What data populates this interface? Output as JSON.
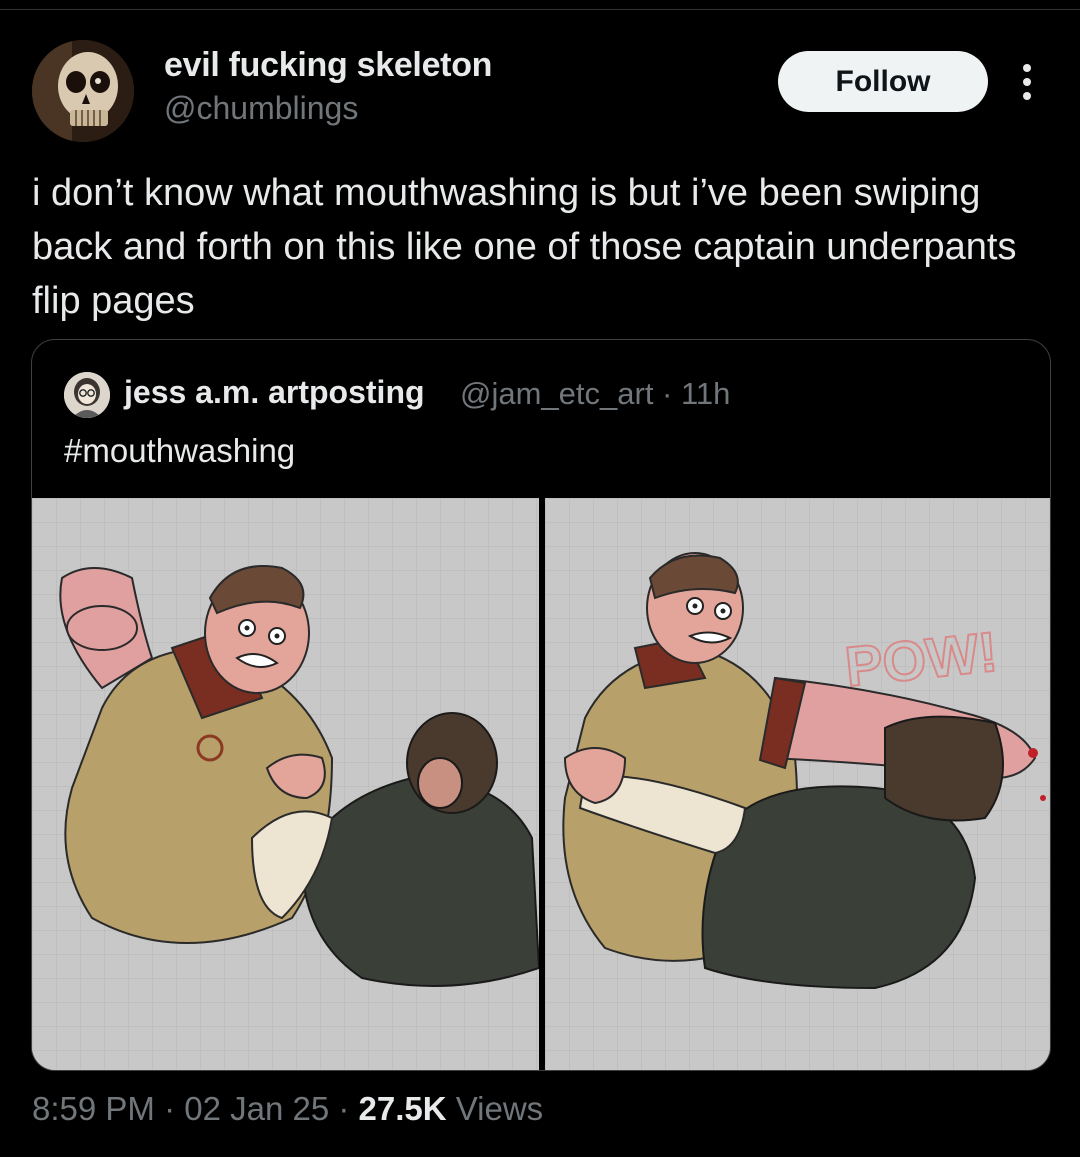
{
  "author": {
    "display_name": "evil fucking skeleton",
    "handle": "@chumblings",
    "avatar_icon": "skull-avatar"
  },
  "actions": {
    "follow_label": "Follow",
    "more_icon": "more-vertical-icon"
  },
  "tweet": {
    "text": "i don’t know what mouthwashing is but i’ve been swiping back and forth on this like one of those captain underpants flip pages"
  },
  "quoted_tweet": {
    "display_name": "jess a.m. artposting",
    "meta": "@jam_etc_art · 11h",
    "text": "#mouthwashing",
    "avatar_icon": "artist-avatar",
    "media": {
      "panels": [
        "fight-panel-1",
        "fight-panel-2"
      ],
      "sfx_text": "POW!"
    }
  },
  "footer": {
    "time": "8:59 PM · 02 Jan 25 · ",
    "views_count": "27.5K",
    "views_label": " Views"
  },
  "colors": {
    "background": "#000000",
    "text_primary": "#e7e9ea",
    "text_secondary": "#71767b",
    "follow_bg": "#eff3f4",
    "border": "#3b4043"
  }
}
